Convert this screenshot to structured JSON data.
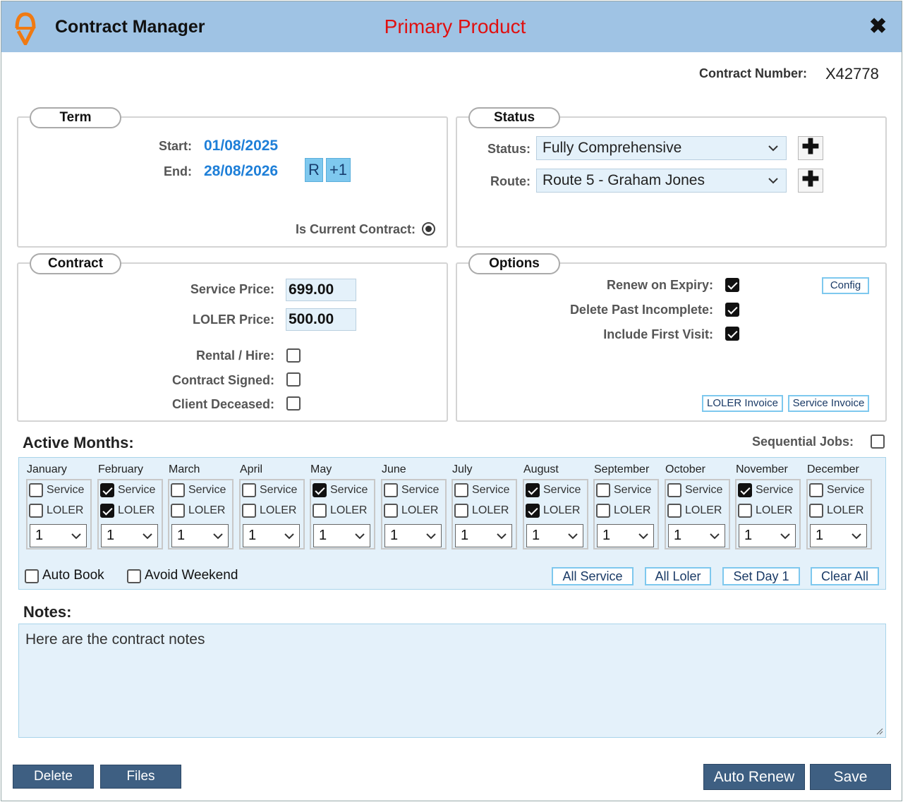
{
  "header": {
    "title": "Contract Manager",
    "subtitle": "Primary Product",
    "close_symbol": "✖"
  },
  "contract_number": {
    "label": "Contract Number:",
    "value": "X42778"
  },
  "term": {
    "title": "Term",
    "start_label": "Start:",
    "start_value": "01/08/2025",
    "end_label": "End:",
    "end_value": "28/08/2026",
    "r_button": "R",
    "plus_one_button": "+1",
    "is_current_label": "Is Current Contract:"
  },
  "status": {
    "title": "Status",
    "status_label": "Status:",
    "status_value": "Fully Comprehensive",
    "route_label": "Route:",
    "route_value": "Route 5 - Graham Jones",
    "add_symbol": "✚"
  },
  "contract": {
    "title": "Contract",
    "service_price_label": "Service Price:",
    "service_price_value": "699.00",
    "loler_price_label": "LOLER Price:",
    "loler_price_value": "500.00",
    "rental_label": "Rental / Hire:",
    "signed_label": "Contract Signed:",
    "deceased_label": "Client Deceased:"
  },
  "options": {
    "title": "Options",
    "renew_label": "Renew on Expiry:",
    "delete_past_label": "Delete Past Incomplete:",
    "include_first_label": "Include First Visit:",
    "config_button": "Config",
    "loler_invoice_button": "LOLER Invoice",
    "service_invoice_button": "Service Invoice"
  },
  "active_months": {
    "title": "Active Months:",
    "sequential_label": "Sequential Jobs:",
    "service_label": "Service",
    "loler_label": "LOLER",
    "months": [
      {
        "name": "January",
        "service": false,
        "loler": false,
        "day": "1"
      },
      {
        "name": "February",
        "service": true,
        "loler": true,
        "day": "1"
      },
      {
        "name": "March",
        "service": false,
        "loler": false,
        "day": "1"
      },
      {
        "name": "April",
        "service": false,
        "loler": false,
        "day": "1"
      },
      {
        "name": "May",
        "service": true,
        "loler": false,
        "day": "1"
      },
      {
        "name": "June",
        "service": false,
        "loler": false,
        "day": "1"
      },
      {
        "name": "July",
        "service": false,
        "loler": false,
        "day": "1"
      },
      {
        "name": "August",
        "service": true,
        "loler": true,
        "day": "1"
      },
      {
        "name": "September",
        "service": false,
        "loler": false,
        "day": "1"
      },
      {
        "name": "October",
        "service": false,
        "loler": false,
        "day": "1"
      },
      {
        "name": "November",
        "service": true,
        "loler": false,
        "day": "1"
      },
      {
        "name": "December",
        "service": false,
        "loler": false,
        "day": "1"
      }
    ],
    "auto_book_label": "Auto Book",
    "avoid_weekend_label": "Avoid Weekend",
    "all_service_button": "All Service",
    "all_loler_button": "All Loler",
    "set_day_button": "Set Day 1",
    "clear_all_button": "Clear All"
  },
  "notes": {
    "title": "Notes:",
    "value": "Here are the contract notes"
  },
  "footer": {
    "delete_button": "Delete",
    "files_button": "Files",
    "auto_renew_button": "Auto Renew",
    "save_button": "Save"
  },
  "colors": {
    "header_bg": "#9fc3e4",
    "subtitle_red": "#e01010",
    "date_blue": "#1e7fd8",
    "field_bg": "#e4f1fa",
    "footer_btn": "#3e5f82"
  }
}
